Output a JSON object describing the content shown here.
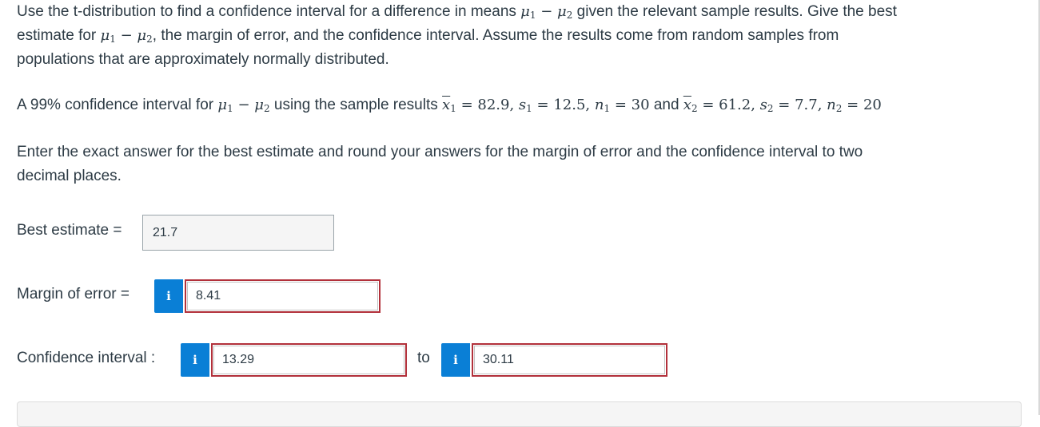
{
  "question": {
    "intro_prefix": "Use the t-distribution to find a confidence interval for a difference in means ",
    "intro_mid": " given the relevant sample results. Give the best",
    "intro_line2_prefix": "estimate for ",
    "intro_line2_suffix": ", the margin of error, and the confidence interval. Assume the results come from random samples from",
    "intro_line3": "populations that are approximately normally distributed.",
    "ci_prefix": "A 99% confidence interval for ",
    "ci_mid": " using the sample results ",
    "x1": "82.9",
    "s1": "12.5",
    "n1": "30",
    "and_text": "and",
    "x2": "61.2",
    "s2": "7.7",
    "n2": "20",
    "instruction_line1": "Enter the exact answer for the best estimate and round your answers for the margin of error and the confidence interval to two",
    "instruction_line2": "decimal places."
  },
  "answers": {
    "best_estimate_label": "Best estimate =",
    "best_estimate_value": "21.7",
    "margin_label": "Margin of error =",
    "margin_value": "8.41",
    "ci_label": "Confidence interval :",
    "ci_lower": "13.29",
    "to_text": "to",
    "ci_upper": "30.11",
    "info_glyph": "i"
  },
  "colors": {
    "info_button": "#0a7fd6",
    "incorrect_border": "#b2303a",
    "text": "#2d3b45"
  },
  "icons": {
    "info": "info-icon"
  }
}
